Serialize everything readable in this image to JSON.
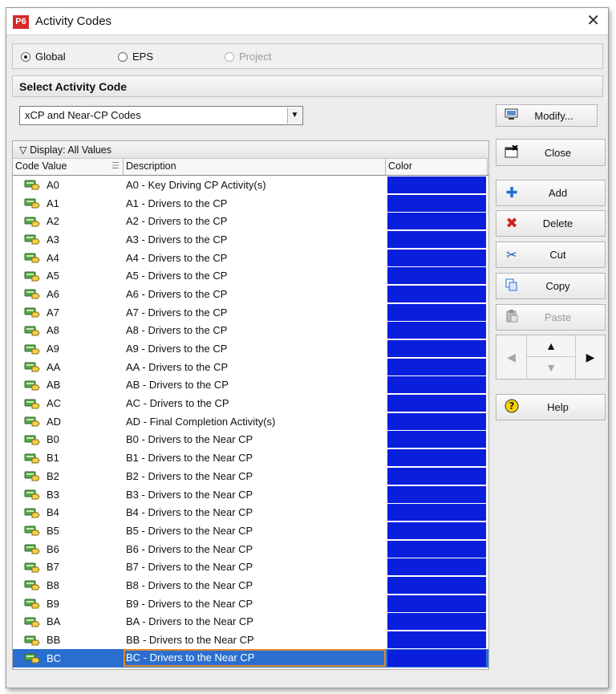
{
  "window": {
    "app_icon_text": "P6",
    "title": "Activity Codes"
  },
  "scope": {
    "options": [
      {
        "label": "Global",
        "selected": true,
        "disabled": false
      },
      {
        "label": "EPS",
        "selected": false,
        "disabled": false
      },
      {
        "label": "Project",
        "selected": false,
        "disabled": true
      }
    ]
  },
  "select_header": "Select Activity Code",
  "code_type": {
    "value": "xCP and Near-CP Codes"
  },
  "grid": {
    "display_label": "Display: All Values",
    "columns": [
      "Code Value",
      "Description",
      "Color"
    ],
    "color_value": "#0a1fdc",
    "rows": [
      {
        "code": "A0",
        "desc": "A0 - Key Driving CP Activity(s)"
      },
      {
        "code": "A1",
        "desc": "A1 - Drivers to the CP"
      },
      {
        "code": "A2",
        "desc": "A2 - Drivers to the CP"
      },
      {
        "code": "A3",
        "desc": "A3 - Drivers to the CP"
      },
      {
        "code": "A4",
        "desc": "A4 - Drivers to the CP"
      },
      {
        "code": "A5",
        "desc": "A5 - Drivers to the CP"
      },
      {
        "code": "A6",
        "desc": "A6 - Drivers to the CP"
      },
      {
        "code": "A7",
        "desc": "A7 - Drivers to the CP"
      },
      {
        "code": "A8",
        "desc": "A8 - Drivers to the CP"
      },
      {
        "code": "A9",
        "desc": "A9 - Drivers to the CP"
      },
      {
        "code": "AA",
        "desc": "AA - Drivers to the CP"
      },
      {
        "code": "AB",
        "desc": "AB - Drivers to the CP"
      },
      {
        "code": "AC",
        "desc": "AC - Drivers to the CP"
      },
      {
        "code": "AD",
        "desc": "AD - Final Completion Activity(s)"
      },
      {
        "code": "B0",
        "desc": "B0 - Drivers to the Near CP"
      },
      {
        "code": "B1",
        "desc": "B1 - Drivers to the Near CP"
      },
      {
        "code": "B2",
        "desc": "B2 - Drivers to the Near CP"
      },
      {
        "code": "B3",
        "desc": "B3 - Drivers to the Near CP"
      },
      {
        "code": "B4",
        "desc": "B4 - Drivers to the Near CP"
      },
      {
        "code": "B5",
        "desc": "B5 - Drivers to the Near CP"
      },
      {
        "code": "B6",
        "desc": "B6 - Drivers to the Near CP"
      },
      {
        "code": "B7",
        "desc": "B7 - Drivers to the Near CP"
      },
      {
        "code": "B8",
        "desc": "B8 - Drivers to the Near CP"
      },
      {
        "code": "B9",
        "desc": "B9 - Drivers to the Near CP"
      },
      {
        "code": "BA",
        "desc": "BA - Drivers to the Near CP"
      },
      {
        "code": "BB",
        "desc": "BB - Drivers to the Near CP"
      },
      {
        "code": "BC",
        "desc": "BC - Drivers to the Near CP",
        "selected": true
      }
    ]
  },
  "buttons": {
    "modify": {
      "label": "Modify...",
      "icon": "modify-icon"
    },
    "close": {
      "label": "Close",
      "icon": "close-window-icon"
    },
    "add": {
      "label": "Add",
      "icon": "plus-icon"
    },
    "delete": {
      "label": "Delete",
      "icon": "red-x-icon"
    },
    "cut": {
      "label": "Cut",
      "icon": "scissors-icon"
    },
    "copy": {
      "label": "Copy",
      "icon": "copy-icon"
    },
    "paste": {
      "label": "Paste",
      "icon": "clipboard-icon",
      "disabled": true
    },
    "help": {
      "label": "Help",
      "icon": "help-icon"
    }
  },
  "colors": {
    "selection": "#2a6fd0",
    "focus_outline": "#e0862c",
    "code_color": "#0a1fdc"
  }
}
